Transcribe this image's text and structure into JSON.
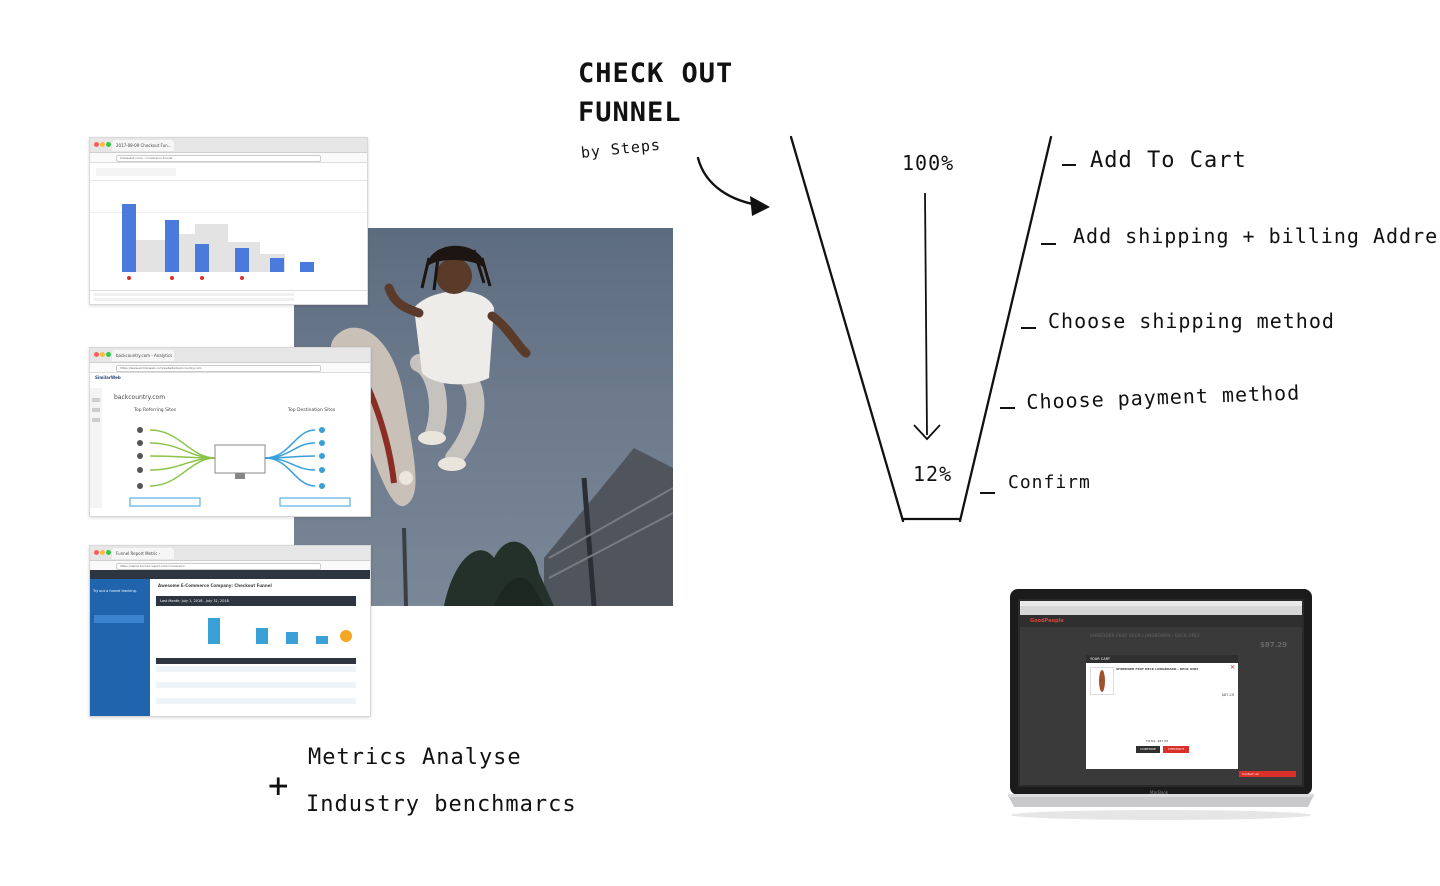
{
  "heading": {
    "line1": "CHECK OUT",
    "line2": "FUNNEL",
    "subtitle": "by Steps"
  },
  "funnel": {
    "top_percent": "100%",
    "bottom_percent": "12%",
    "steps": [
      "Add To Cart",
      "Add shipping + billing Address",
      "Choose shipping method",
      "Choose payment method",
      "Confirm"
    ]
  },
  "notes": {
    "plus": "+",
    "line1": "Metrics Analyse",
    "line2": "Industry benchmarcs"
  },
  "screenshot_analytics": {
    "tab": "2017-08-09 Checkout Fun...",
    "url": "hirequest.com/...conversion-funnel"
  },
  "screenshot_similarweb": {
    "tab": "backcountry.com - Analytics",
    "url": "https://www.similarweb.com/website/backcountry.com",
    "brand": "SimilarWeb",
    "site": "backcountry.com",
    "left_title": "Top Referring Sites",
    "right_title": "Top Destination Sites",
    "left_button": "Identify more Referring Sites",
    "right_button": "See 1 More Destination Sites"
  },
  "screenshot_funnel_report": {
    "tab": "Funnel Report Metric - Report",
    "url": "https://demo.funnel-report.com/conversion",
    "title": "Awesome E-Commerce Company: Checkout Funnel",
    "date_range": "Last Month: July 1, 2018 - July 31, 2018",
    "side_text": "Try out a funnel tracking.",
    "side_button": "Request a demo"
  },
  "laptop": {
    "brand": "GoodPeople",
    "product": "SHREDDER FRAY DECK LONGBOARD - DECK ONLY",
    "price": "$87.29",
    "cart_title": "YOUR CART",
    "total": "TOTAL: $87.29",
    "continue": "CONTINUE",
    "checkout": "CHECKOUT",
    "contact": "Contact us!",
    "caption": "MacBook"
  },
  "colors": {
    "ink": "#111111",
    "bar_blue": "#4a7bdc",
    "similarweb_green": "#8bc34a",
    "similarweb_blue": "#3aa0d8",
    "report_blue": "#1f64ad",
    "accent_red": "#d9302a"
  }
}
